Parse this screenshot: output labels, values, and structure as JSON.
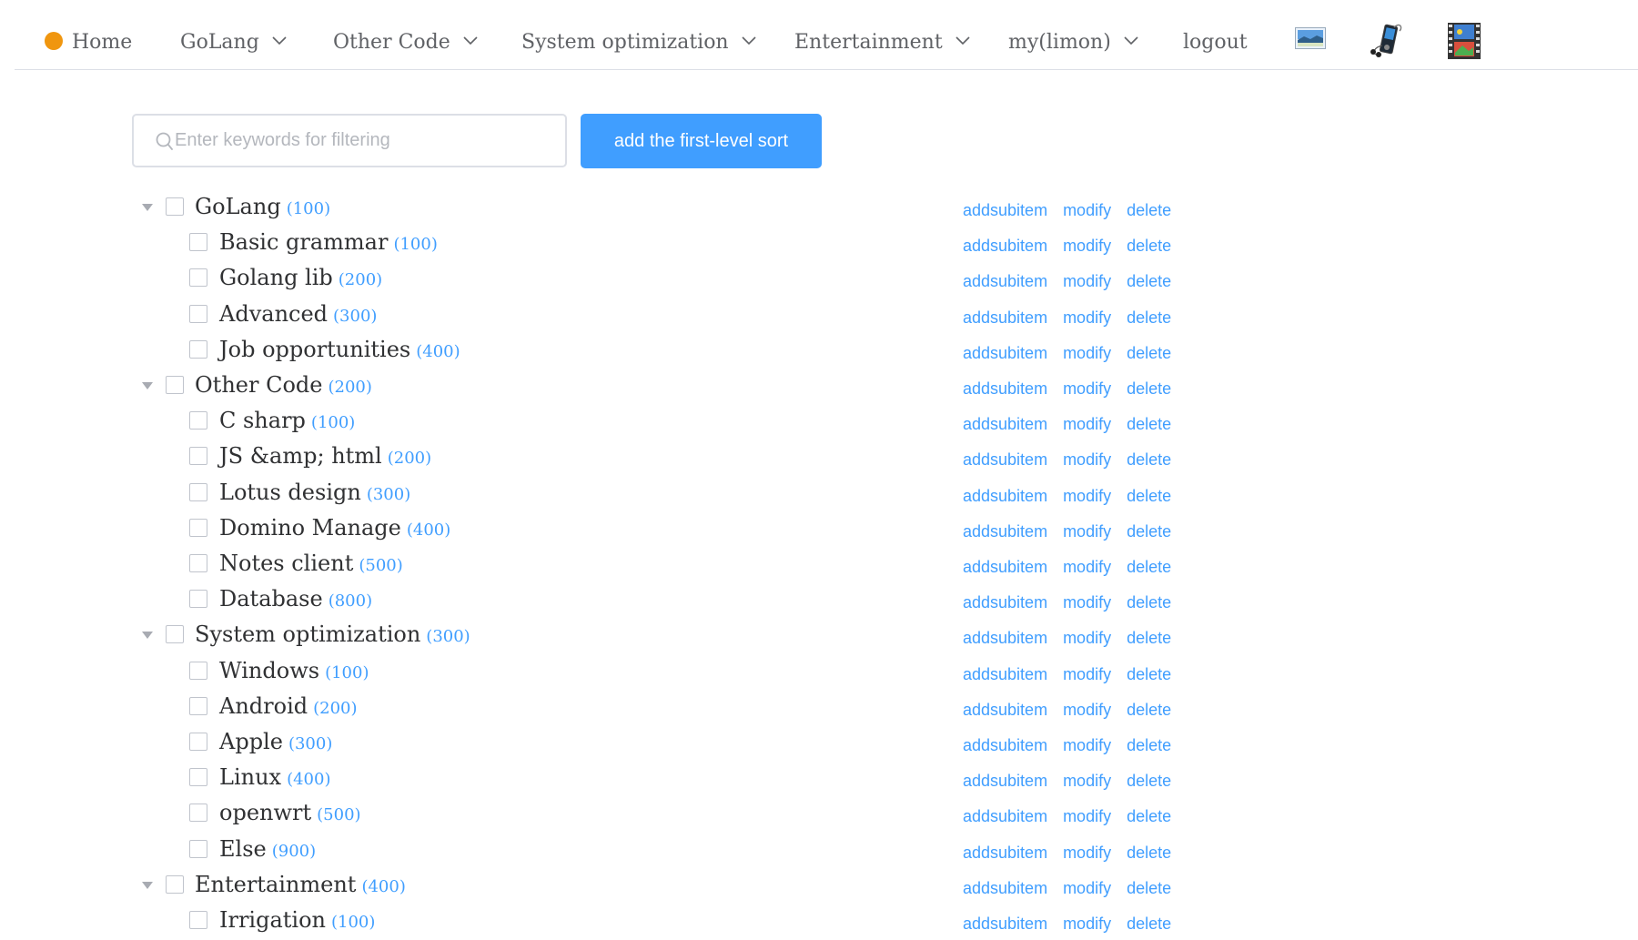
{
  "nav": {
    "home": "Home",
    "menus": [
      "GoLang",
      "Other Code",
      "System optimization",
      "Entertainment",
      "my(limon)"
    ],
    "logout": "logout",
    "icons": [
      "landscape-image-icon",
      "mp3-player-icon",
      "film-strip-icon"
    ]
  },
  "toolbar": {
    "filter_placeholder": "Enter keywords for filtering",
    "add_button": "add the first-level sort"
  },
  "actions": {
    "add": "addsubitem",
    "modify": "modify",
    "delete": "delete"
  },
  "tree": [
    {
      "label": "GoLang",
      "count": "(100)",
      "level": 1
    },
    {
      "label": "Basic grammar",
      "count": "(100)",
      "level": 2
    },
    {
      "label": "Golang lib",
      "count": "(200)",
      "level": 2
    },
    {
      "label": "Advanced",
      "count": "(300)",
      "level": 2
    },
    {
      "label": "Job opportunities",
      "count": "(400)",
      "level": 2
    },
    {
      "label": "Other Code",
      "count": "(200)",
      "level": 1
    },
    {
      "label": "C sharp",
      "count": "(100)",
      "level": 2
    },
    {
      "label": "JS &amp; html",
      "count": "(200)",
      "level": 2
    },
    {
      "label": "Lotus design",
      "count": "(300)",
      "level": 2
    },
    {
      "label": "Domino Manage",
      "count": "(400)",
      "level": 2
    },
    {
      "label": "Notes client",
      "count": "(500)",
      "level": 2
    },
    {
      "label": "Database",
      "count": "(800)",
      "level": 2
    },
    {
      "label": "System optimization",
      "count": "(300)",
      "level": 1
    },
    {
      "label": "Windows",
      "count": "(100)",
      "level": 2
    },
    {
      "label": "Android",
      "count": "(200)",
      "level": 2
    },
    {
      "label": "Apple",
      "count": "(300)",
      "level": 2
    },
    {
      "label": "Linux",
      "count": "(400)",
      "level": 2
    },
    {
      "label": "openwrt",
      "count": "(500)",
      "level": 2
    },
    {
      "label": "Else",
      "count": "(900)",
      "level": 2
    },
    {
      "label": "Entertainment",
      "count": "(400)",
      "level": 1
    },
    {
      "label": "Irrigation",
      "count": "(100)",
      "level": 2
    }
  ]
}
